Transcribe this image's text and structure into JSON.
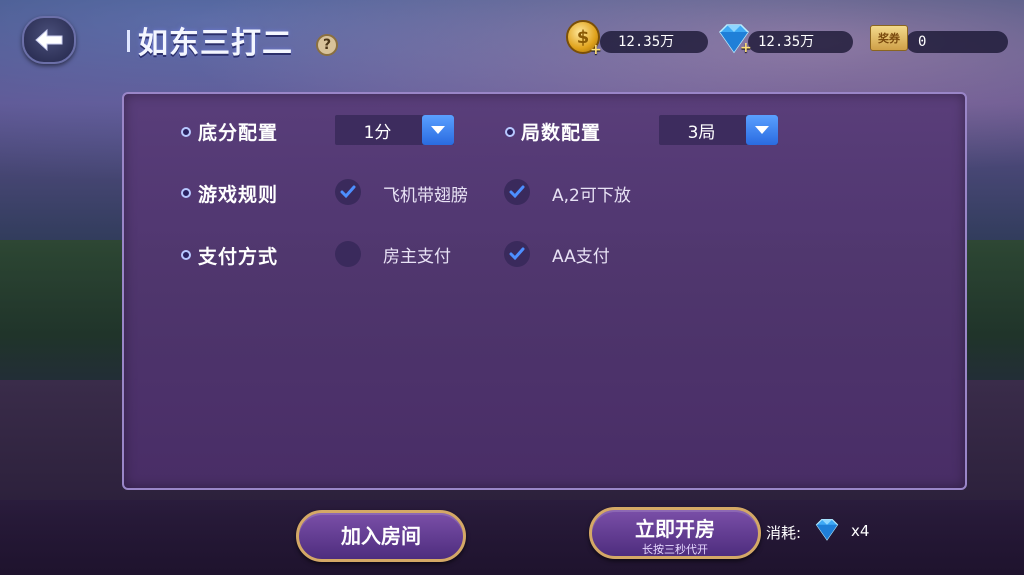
{
  "header": {
    "title": "如东三打二",
    "help_icon": "?",
    "back_icon": "arrow-left-icon"
  },
  "currency": {
    "gold": "12.35万",
    "diamond": "12.35万",
    "ticket_label": "奖券",
    "ticket": "0",
    "coin_symbol": "$"
  },
  "settings": {
    "base_score": {
      "label": "底分配置",
      "value": "1分"
    },
    "rounds": {
      "label": "局数配置",
      "value": "3局"
    },
    "rules": {
      "label": "游戏规则",
      "options": [
        {
          "text": "飞机带翅膀",
          "checked": true
        },
        {
          "text": "A,2可下放",
          "checked": true
        }
      ]
    },
    "payment": {
      "label": "支付方式",
      "options": [
        {
          "text": "房主支付",
          "checked": false
        },
        {
          "text": "AA支付",
          "checked": true
        }
      ]
    }
  },
  "footer": {
    "join_label": "加入房间",
    "create_label": "立即开房",
    "create_sublabel": "长按三秒代开",
    "cost_label": "消耗:",
    "cost_count": "x4"
  },
  "colors": {
    "panel": "#5a3c7a",
    "accent_blue": "#3a7ef0",
    "button_border": "#d4a866"
  }
}
